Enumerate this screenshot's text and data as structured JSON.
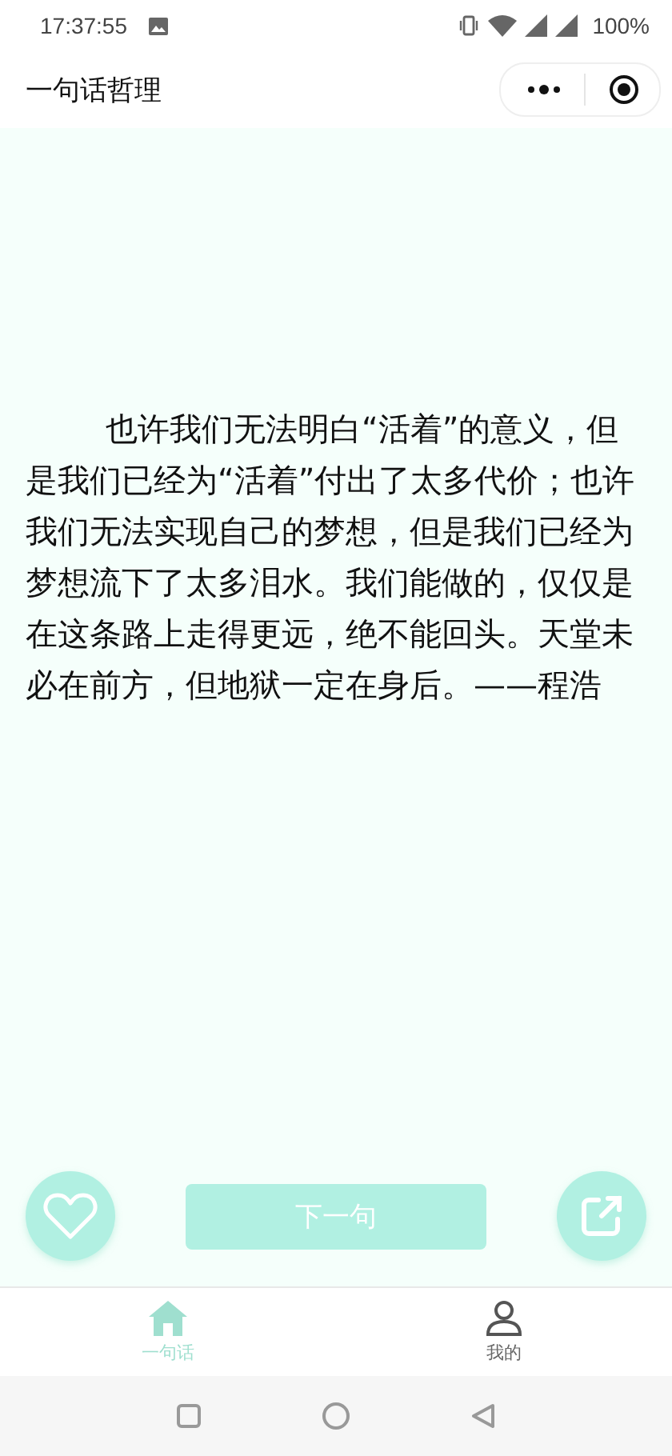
{
  "status_bar": {
    "time": "17:37:55",
    "battery": "100%"
  },
  "header": {
    "title": "一句话哲理"
  },
  "quote": {
    "text": "也许我们无法明白“活着”的意义，但是我们已经为“活着”付出了太多代价；也许我们无法实现自己的梦想，但是我们已经为梦想流下了太多泪水。我们能做的，仅仅是在这条路上走得更远，绝不能回头。天堂未必在前方，但地狱一定在身后。——程浩"
  },
  "actions": {
    "next_button": "下一句"
  },
  "tabs": [
    {
      "label": "一句话",
      "kind": "home",
      "selected": true
    },
    {
      "label": "我的",
      "kind": "profile",
      "selected": false
    }
  ]
}
